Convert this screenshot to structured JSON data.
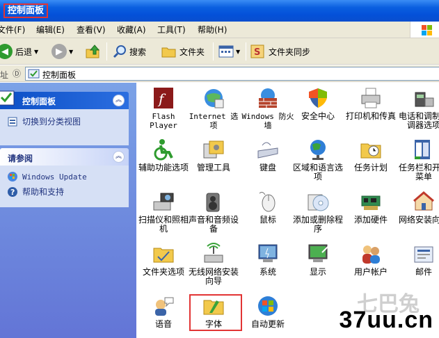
{
  "window": {
    "title": "控制面板"
  },
  "menu": [
    "文件(F)",
    "编辑(E)",
    "查看(V)",
    "收藏(A)",
    "工具(T)",
    "帮助(H)"
  ],
  "toolbar": {
    "back": "后退",
    "search": "搜索",
    "folders": "文件夹",
    "sync": "文件夹同步"
  },
  "address": {
    "label": "址",
    "value": "控制面板"
  },
  "sidebar": {
    "panel1": {
      "title": "控制面板",
      "link": "切换到分类视图"
    },
    "panel2": {
      "title": "请参阅",
      "links": [
        "Windows Update",
        "帮助和支持"
      ]
    }
  },
  "items": [
    {
      "label": "Flash Player",
      "icon": "flash-icon"
    },
    {
      "label": "Internet 选项",
      "icon": "internet-options-icon"
    },
    {
      "label": "Windows 防火墙",
      "icon": "firewall-icon"
    },
    {
      "label": "安全中心",
      "icon": "security-center-icon"
    },
    {
      "label": "打印机和传真",
      "icon": "printer-icon"
    },
    {
      "label": "电话和调制解调器选项",
      "icon": "phone-modem-icon"
    },
    {
      "label": "辅助功能选项",
      "icon": "accessibility-icon"
    },
    {
      "label": "管理工具",
      "icon": "admin-tools-icon"
    },
    {
      "label": "键盘",
      "icon": "keyboard-icon"
    },
    {
      "label": "区域和语言选项",
      "icon": "globe-icon"
    },
    {
      "label": "任务计划",
      "icon": "scheduled-tasks-icon"
    },
    {
      "label": "任务栏和开始菜单",
      "icon": "taskbar-icon"
    },
    {
      "label": "扫描仪和照相机",
      "icon": "scanner-icon"
    },
    {
      "label": "声音和音频设备",
      "icon": "speaker-icon"
    },
    {
      "label": "鼠标",
      "icon": "mouse-icon"
    },
    {
      "label": "添加或删除程序",
      "icon": "add-remove-icon"
    },
    {
      "label": "添加硬件",
      "icon": "add-hardware-icon"
    },
    {
      "label": "网络安装向导",
      "icon": "network-setup-icon"
    },
    {
      "label": "文件夹选项",
      "icon": "folder-options-icon"
    },
    {
      "label": "无线网络安装向导",
      "icon": "wireless-icon"
    },
    {
      "label": "系统",
      "icon": "system-icon"
    },
    {
      "label": "显示",
      "icon": "display-icon"
    },
    {
      "label": "用户帐户",
      "icon": "user-accounts-icon"
    },
    {
      "label": "邮件",
      "icon": "mail-icon"
    },
    {
      "label": "语音",
      "icon": "speech-icon"
    },
    {
      "label": "字体",
      "icon": "fonts-icon"
    },
    {
      "label": "自动更新",
      "icon": "windows-update-icon"
    }
  ],
  "watermark": "37uu.cn",
  "watermark_ghost": "七巴兔",
  "colors": {
    "titlebar": "#0a5fe0",
    "highlight": "#e23434",
    "sidebar": "#7ba2e7"
  }
}
